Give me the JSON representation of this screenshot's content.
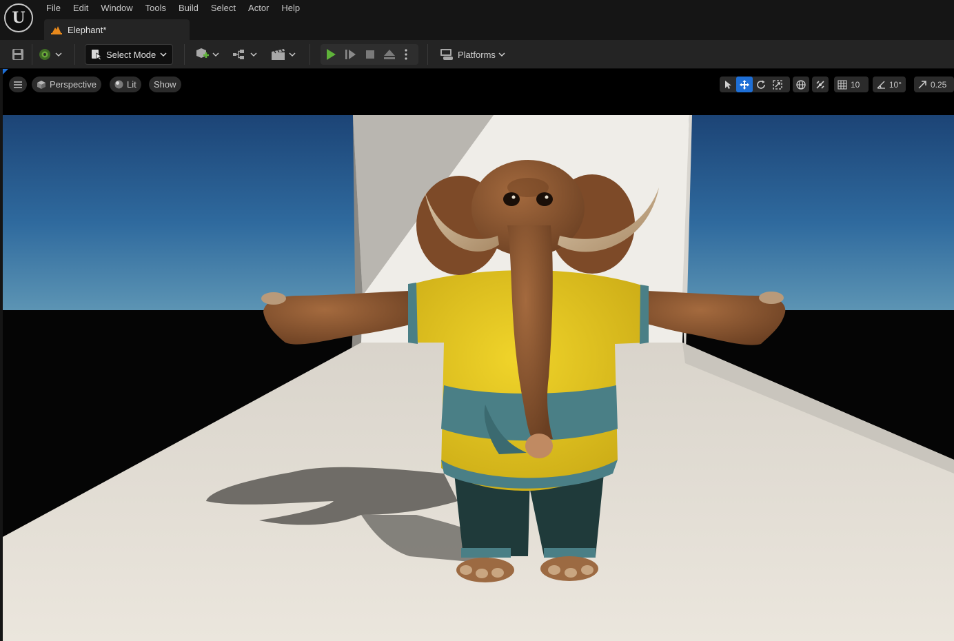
{
  "app": {
    "logo": "unreal-engine-logo"
  },
  "menu": {
    "items": [
      "File",
      "Edit",
      "Window",
      "Tools",
      "Build",
      "Select",
      "Actor",
      "Help"
    ]
  },
  "tab": {
    "label": "Elephant*",
    "icon": "level-icon"
  },
  "toolbar": {
    "save_icon": "save-icon",
    "source_control_icon": "source-control-icon",
    "select_mode_label": "Select Mode",
    "add_icon": "add-actor-icon",
    "blueprint_icon": "blueprint-icon",
    "cinematics_icon": "cinematics-icon",
    "play_icon": "play-icon",
    "step_icon": "step-icon",
    "stop_icon": "stop-icon",
    "eject_icon": "eject-icon",
    "more_icon": "more-options-icon",
    "platforms_label": "Platforms"
  },
  "viewport": {
    "perspective_label": "Perspective",
    "lit_label": "Lit",
    "show_label": "Show",
    "grid_snap_value": "10",
    "rotation_snap_value": "10°",
    "scale_snap_value": "0.25"
  },
  "colors": {
    "accent": "#1e6fd6",
    "play_green": "#5fb33a",
    "shirt_yellow": "#e6c81e",
    "shirt_trim": "#4a7f86",
    "shorts": "#1f3a3a",
    "elephant_skin": "#8a5530"
  }
}
